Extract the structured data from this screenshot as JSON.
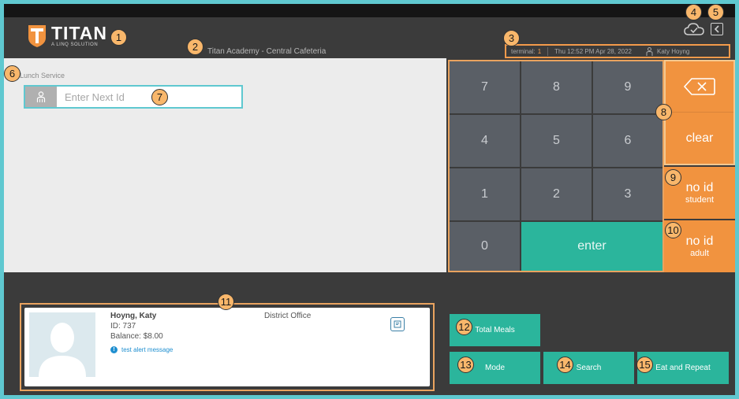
{
  "header": {
    "logo_main": "TITAN",
    "logo_sub": "A LINQ SOLUTION",
    "location": "Titan Academy - Central Cafeteria",
    "status": {
      "terminal_label": "terminal:",
      "terminal_value": "1",
      "datetime": "Thu 12:52 PM Apr 28, 2022",
      "user": "Katy Hoyng"
    },
    "icons": {
      "sync": "cloud-check-icon",
      "back": "chevron-left-icon"
    }
  },
  "service": {
    "label": "Lunch Service",
    "id_placeholder": "Enter Next Id"
  },
  "keypad": {
    "keys": [
      "7",
      "8",
      "9",
      "4",
      "5",
      "6",
      "1",
      "2",
      "3",
      "0"
    ],
    "enter": "enter",
    "clear": "clear",
    "no_id_student": {
      "main": "no id",
      "sub": "student"
    },
    "no_id_adult": {
      "main": "no id",
      "sub": "adult"
    }
  },
  "patron": {
    "name": "Hoyng, Katy",
    "id": "ID: 737",
    "balance": "Balance: $8.00",
    "alert": "test alert message",
    "department": "District Office"
  },
  "actions": {
    "total_meals": "Total Meals",
    "mode": "Mode",
    "search": "Search",
    "eat_repeat": "Eat and Repeat"
  },
  "callouts": [
    "1",
    "2",
    "3",
    "4",
    "5",
    "6",
    "7",
    "8",
    "9",
    "10",
    "11",
    "12",
    "13",
    "14",
    "15"
  ],
  "colors": {
    "accent_orange": "#f1933f",
    "accent_teal": "#2bb59c",
    "key_gray": "#5a5f66",
    "header_dark": "#3b3b3b"
  }
}
